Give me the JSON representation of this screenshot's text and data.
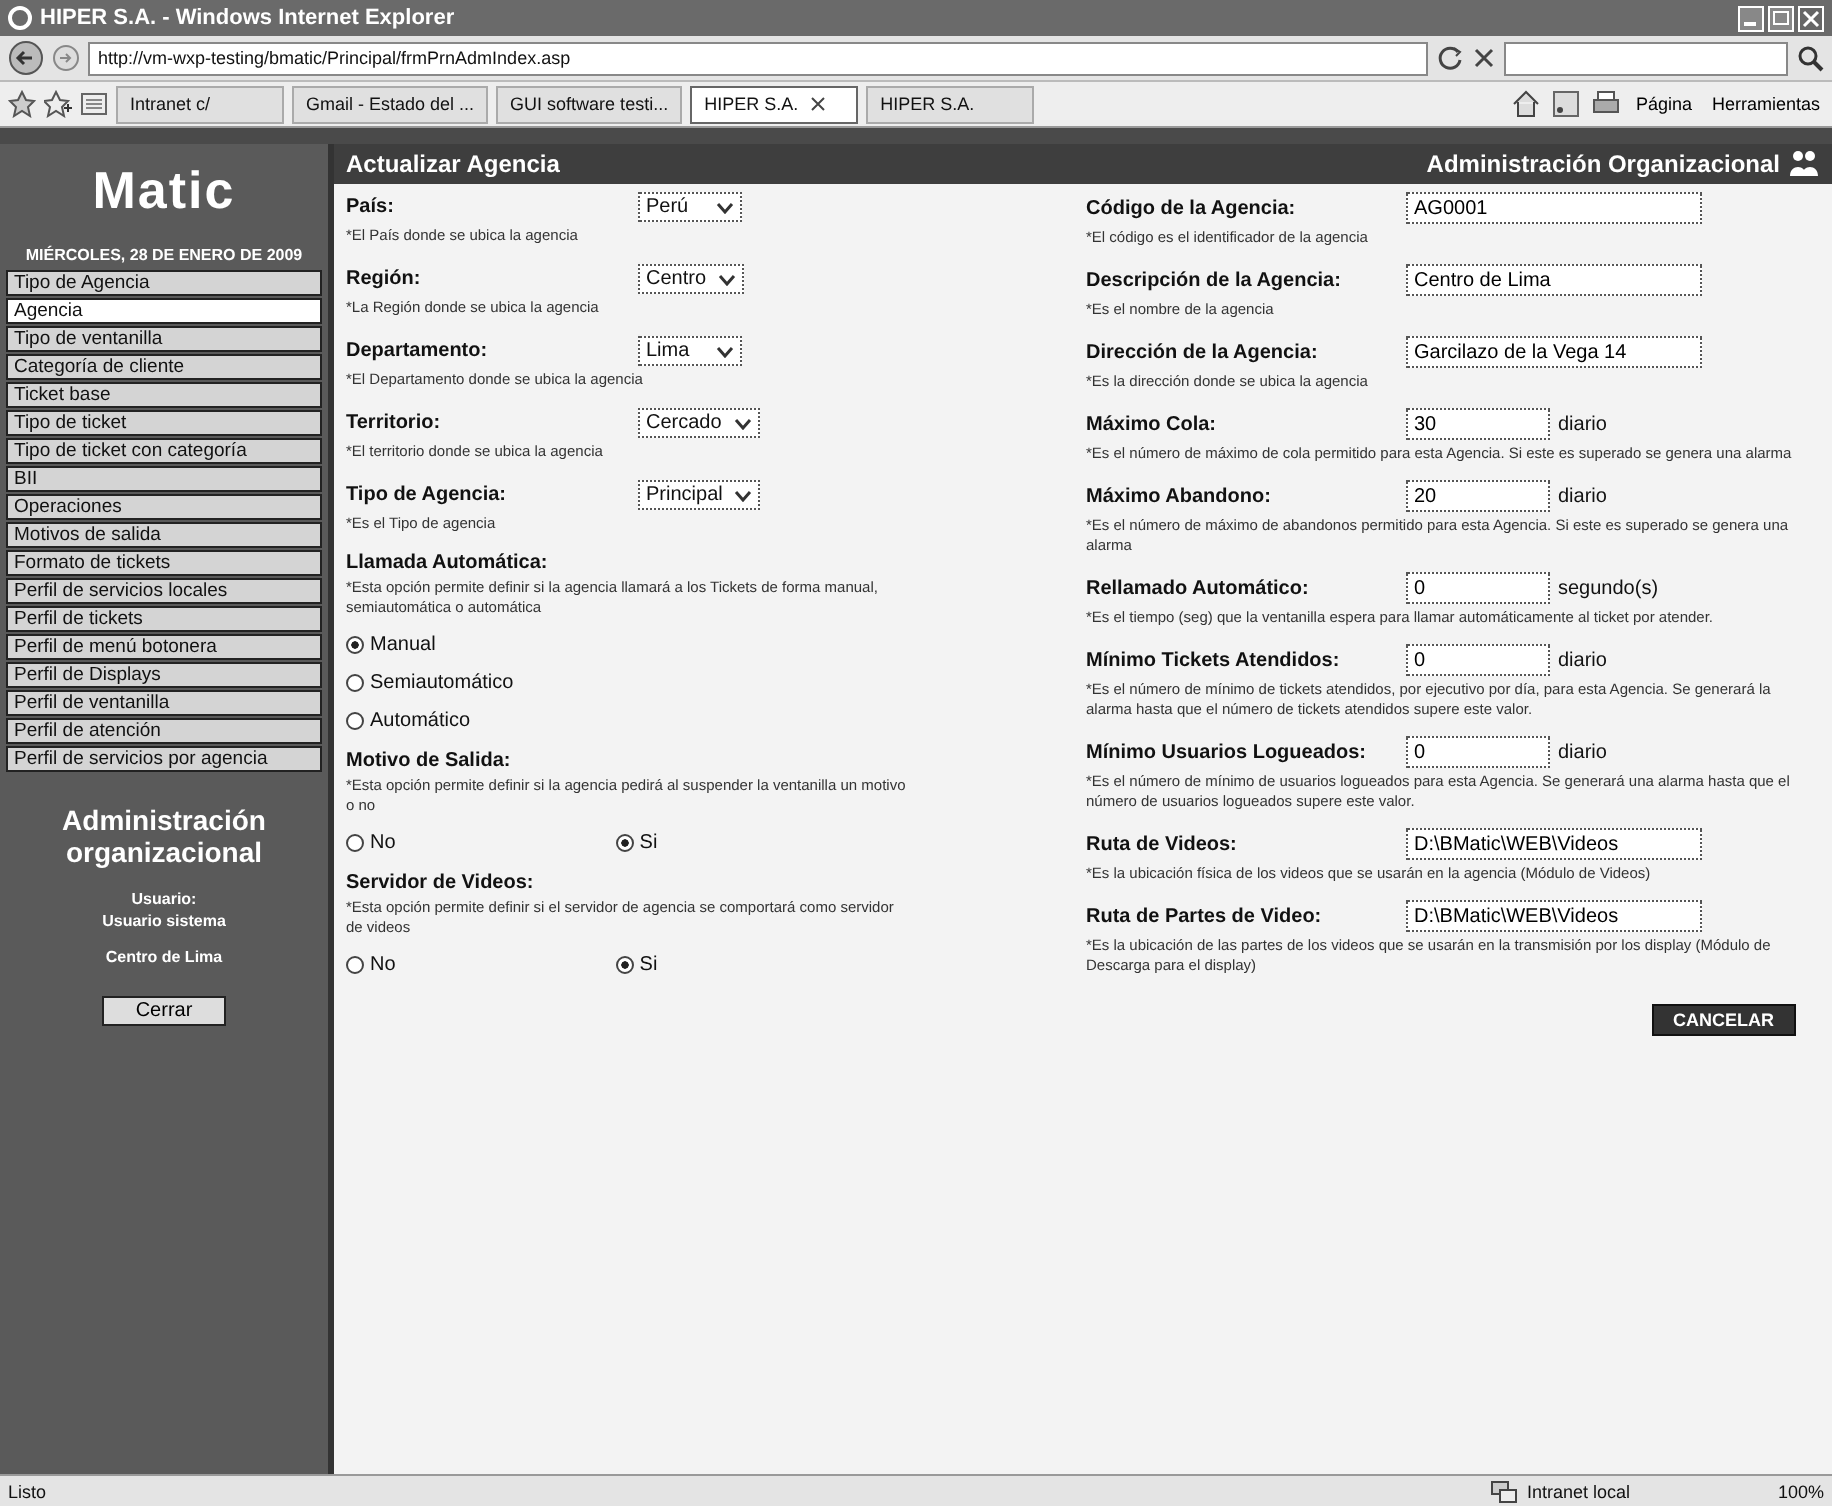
{
  "window": {
    "title": "HIPER S.A. - Windows Internet Explorer"
  },
  "browser": {
    "address": "http://vm-wxp-testing/bmatic/Principal/frmPrnAdmIndex.asp",
    "tabs": [
      {
        "label": "Intranet c/",
        "selected": false
      },
      {
        "label": "Gmail - Estado del ...",
        "selected": false
      },
      {
        "label": "GUI software testi...",
        "selected": false
      },
      {
        "label": "HIPER S.A.",
        "selected": true
      },
      {
        "label": "HIPER S.A.",
        "selected": false
      }
    ],
    "toolbar": [
      "Página",
      "Herramientas"
    ]
  },
  "sidebar": {
    "logo": "Matic",
    "date": "MIÉRCOLES, 28 DE ENERO DE 2009",
    "menu": [
      {
        "label": "Tipo de Agencia",
        "selected": false
      },
      {
        "label": "Agencia",
        "selected": true
      },
      {
        "label": "Tipo de ventanilla",
        "selected": false
      },
      {
        "label": "Categoría de cliente",
        "selected": false
      },
      {
        "label": "Ticket base",
        "selected": false
      },
      {
        "label": "Tipo de ticket",
        "selected": false
      },
      {
        "label": "Tipo de ticket con categoría",
        "selected": false
      },
      {
        "label": "BII",
        "selected": false
      },
      {
        "label": "Operaciones",
        "selected": false
      },
      {
        "label": "Motivos de salida",
        "selected": false
      },
      {
        "label": "Formato de tickets",
        "selected": false
      },
      {
        "label": "Perfil de servicios locales",
        "selected": false
      },
      {
        "label": "Perfil de tickets",
        "selected": false
      },
      {
        "label": "Perfil de menú botonera",
        "selected": false
      },
      {
        "label": "Perfil de Displays",
        "selected": false
      },
      {
        "label": "Perfil de ventanilla",
        "selected": false
      },
      {
        "label": "Perfil de atención",
        "selected": false
      },
      {
        "label": "Perfil de servicios por agencia",
        "selected": false
      }
    ],
    "section_title": "Administración organizacional",
    "user_label": "Usuario:",
    "user_name": "Usuario sistema",
    "agency": "Centro de Lima",
    "logout": "Cerrar"
  },
  "main": {
    "title": "Actualizar Agencia",
    "section_title": "Administración Organizacional",
    "left_fields": [
      {
        "kind": "select",
        "label": "País:",
        "value": "Perú",
        "hint": "*El País donde se ubica la agencia"
      },
      {
        "kind": "select",
        "label": "Región:",
        "value": "Centro",
        "hint": "*La Región donde se ubica la agencia"
      },
      {
        "kind": "select",
        "label": "Departamento:",
        "value": "Lima",
        "hint": "*El Departamento donde se ubica la agencia"
      },
      {
        "kind": "select",
        "label": "Territorio:",
        "value": "Cercado",
        "hint": "*El territorio donde se ubica la agencia"
      },
      {
        "kind": "select",
        "label": "Tipo de Agencia:",
        "value": "Principal",
        "hint": "*Es el Tipo de agencia"
      },
      {
        "kind": "radiolist",
        "label": "Llamada Automática:",
        "hint": "*Esta opción permite definir si la agencia llamará a los Tickets de forma manual, semiautomática o automática",
        "options": [
          {
            "label": "Manual",
            "selected": true
          },
          {
            "label": "Semiautomático",
            "selected": false
          },
          {
            "label": "Automático",
            "selected": false
          }
        ]
      },
      {
        "kind": "radiopair",
        "label": "Motivo de Salida:",
        "hint": "*Esta opción permite definir si la agencia pedirá al suspender la ventanilla un motivo o no",
        "options": [
          {
            "label": "No",
            "selected": false
          },
          {
            "label": "Si",
            "selected": true
          }
        ]
      },
      {
        "kind": "radiopair",
        "label": "Servidor de Videos:",
        "hint": "*Esta opción permite definir si el servidor de agencia se comportará como servidor de videos",
        "options": [
          {
            "label": "No",
            "selected": false
          },
          {
            "label": "Si",
            "selected": true
          }
        ]
      }
    ],
    "right_fields": [
      {
        "label": "Código de la Agencia:",
        "value": "AG0001",
        "hint": "*El código es el identificador de la agencia"
      },
      {
        "label": "Descripción de la Agencia:",
        "value": "Centro de Lima",
        "hint": "*Es el nombre de la agencia"
      },
      {
        "label": "Dirección de la Agencia:",
        "value": "Garcilazo de la Vega 14",
        "hint": "*Es la dirección donde se ubica la agencia"
      },
      {
        "label": "Máximo Cola:",
        "value": "30",
        "unit": "diario",
        "hint": "*Es el número de máximo de cola permitido para esta Agencia. Si este es superado se genera una alarma"
      },
      {
        "label": "Máximo Abandono:",
        "value": "20",
        "unit": "diario",
        "hint": "*Es el número de máximo de abandonos permitido para esta Agencia. Si este es superado se genera una alarma"
      },
      {
        "label": "Rellamado Automático:",
        "value": "0",
        "unit": "segundo(s)",
        "hint": "*Es el tiempo (seg) que la ventanilla espera para llamar automáticamente al ticket por atender."
      },
      {
        "label": "Mínimo Tickets Atendidos:",
        "value": "0",
        "unit": "diario",
        "hint": "*Es el número de mínimo de tickets atendidos, por ejecutivo por día, para esta Agencia. Se generará la alarma hasta que el número de tickets atendidos supere este valor."
      },
      {
        "label": "Mínimo Usuarios Logueados:",
        "value": "0",
        "unit": "diario",
        "hint": "*Es el número de mínimo de usuarios logueados para esta Agencia. Se generará una alarma hasta que el número de usuarios logueados supere este valor."
      },
      {
        "label": "Ruta de Videos:",
        "value": "D:\\BMatic\\WEB\\Videos",
        "hint": "*Es la ubicación física de los videos que se usarán en la agencia (Módulo de Videos)"
      },
      {
        "label": "Ruta de Partes de Video:",
        "value": "D:\\BMatic\\WEB\\Videos",
        "hint": "*Es la ubicación de las partes de los videos que se usarán en la transmisión por los display (Módulo de Descarga para el display)"
      }
    ],
    "cancel": "CANCELAR"
  },
  "status_bar": {
    "text": "Listo",
    "zone": "Intranet local",
    "zoom": "100%"
  }
}
